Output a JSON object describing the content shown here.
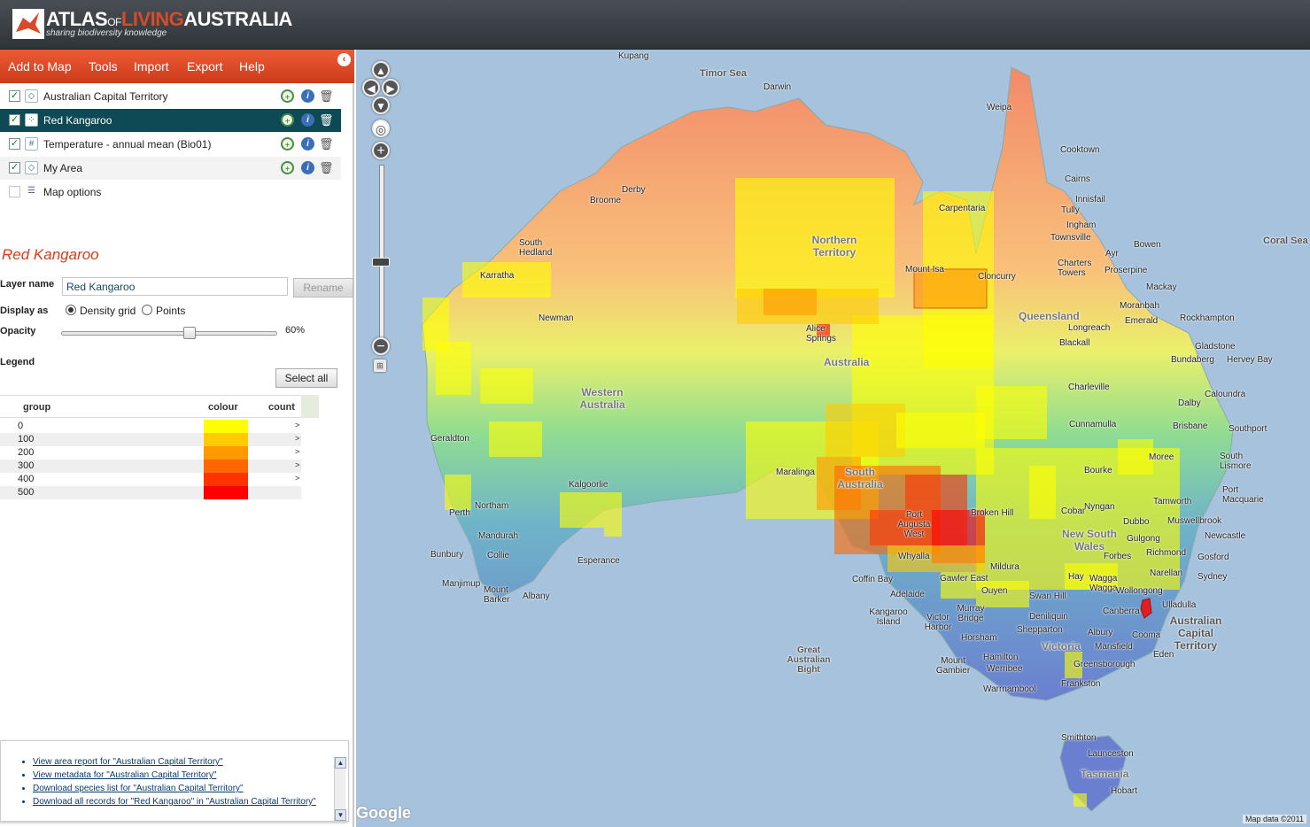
{
  "header": {
    "brand_atlas": "ATLAS",
    "brand_of": "OF",
    "brand_living": "LIVING",
    "brand_australia": "AUSTRALIA",
    "tagline": "sharing biodiversity knowledge",
    "logo_icon": "ala-logo-icon"
  },
  "menu": {
    "items": [
      "Add to Map",
      "Tools",
      "Import",
      "Export",
      "Help"
    ],
    "collapse_icon": "chevron-left-icon"
  },
  "layers": [
    {
      "name": "Australian Capital Territory",
      "checked": true,
      "icon": "area-icon"
    },
    {
      "name": "Red Kangaroo",
      "checked": true,
      "icon": "species-icon"
    },
    {
      "name": "Temperature - annual mean (Bio01)",
      "checked": true,
      "icon": "grid-icon"
    },
    {
      "name": "My Area",
      "checked": true,
      "icon": "area-icon"
    },
    {
      "name": "Map options",
      "checked": false,
      "icon": "list-icon"
    }
  ],
  "layer_panel": {
    "title": "Red Kangaroo",
    "layer_name_label": "Layer name",
    "layer_name_value": "Red Kangaroo",
    "rename_label": "Rename",
    "display_as_label": "Display as",
    "display_options": [
      "Density grid",
      "Points"
    ],
    "display_selected": "Density grid",
    "opacity_label": "Opacity",
    "opacity_value": "60%",
    "opacity_fraction": 0.6,
    "legend_label": "Legend",
    "select_all_label": "Select all"
  },
  "legend": {
    "columns": [
      "group",
      "colour",
      "count"
    ],
    "rows": [
      {
        "group": "0",
        "colour": "#ffff00",
        "count": ">"
      },
      {
        "group": "100",
        "colour": "#ffcc00",
        "count": ">"
      },
      {
        "group": "200",
        "colour": "#ff9900",
        "count": ">"
      },
      {
        "group": "300",
        "colour": "#ff6600",
        "count": ">"
      },
      {
        "group": "400",
        "colour": "#ff3300",
        "count": ">"
      },
      {
        "group": "500",
        "colour": "#ff0000",
        "count": ""
      }
    ]
  },
  "links": [
    "View area report for \"Australian Capital Territory\"",
    "View metadata for \"Australian Capital Territory\"",
    "Download species list for \"Australian Capital Territory\"",
    "Download all records for \"Red Kangaroo\" in \"Australian Capital Territory\""
  ],
  "map": {
    "attribution": "Map data ©2011",
    "google_logo": "Google",
    "labels": {
      "kupang": "Kupang",
      "timor_sea": "Timor Sea",
      "darwin": "Darwin",
      "weipa": "Weipa",
      "derby": "Derby",
      "broome": "Broome",
      "cooktown": "Cooktown",
      "cairns": "Cairns",
      "innisfail": "Innisfail",
      "tully": "Tully",
      "ingham": "Ingham",
      "townsville": "Townsville",
      "bowen": "Bowen",
      "ayr": "Ayr",
      "coral_sea": "Coral Sea",
      "carpentaria": "Carpentaria",
      "south_hedland": "South Hedland",
      "karratha": "Karratha",
      "northern_territory": "Northern Territory",
      "mount_isa": "Mount Isa",
      "cloncurry": "Cloncurry",
      "charters_towers": "Charters Towers",
      "proserpine": "Proserpine",
      "mackay": "Mackay",
      "newman": "Newman",
      "queensland": "Queensland",
      "moranbah": "Moranbah",
      "emerald": "Emerald",
      "rockhampton": "Rockhampton",
      "longreach": "Longreach",
      "alice_springs": "Alice Springs",
      "blackall": "Blackall",
      "gladstone": "Gladstone",
      "australia": "Australia",
      "bundaberg": "Bundaberg",
      "hervey_bay": "Hervey Bay",
      "western_australia": "Western Australia",
      "charleville": "Charleville",
      "caloundra": "Caloundra",
      "dalby": "Dalby",
      "geraldton": "Geraldton",
      "cunnamulla": "Cunnamulla",
      "brisbane": "Brisbane",
      "southport": "Southport",
      "moree": "Moree",
      "south_lismore": "South Lismore",
      "south_australia": "South Australia",
      "bourke": "Bourke",
      "maralinga": "Maralinga",
      "kalgoorlie": "Kalgoorlie",
      "port_macquarie": "Port Macquarie",
      "tamworth": "Tamworth",
      "nyngan": "Nyngan",
      "northam": "Northam",
      "perth": "Perth",
      "port_augusta": "Port Augusta West",
      "broken_hill": "Broken Hill",
      "cobar": "Cobar",
      "dubbo": "Dubbo",
      "muswellbrook": "Muswellbrook",
      "mandurah": "Mandurah",
      "new_south_wales": "New South Wales",
      "gulgong": "Gulgong",
      "newcastle": "Newcastle",
      "bunbury": "Bunbury",
      "collie": "Collie",
      "whyalla": "Whyalla",
      "esperance": "Esperance",
      "mildura": "Mildura",
      "forbes": "Forbes",
      "richmond": "Richmond",
      "gosford": "Gosford",
      "manjimup": "Manjimup",
      "narellan": "Narellan",
      "sydney": "Sydney",
      "coffin_bay": "Coffin Bay",
      "gawler_east": "Gawler East",
      "hay": "Hay",
      "wagga_wagga": "Wagga Wagga",
      "mount_barker": "Mount Barker",
      "albany": "Albany",
      "adelaide": "Adelaide",
      "ouyen": "Ouyen",
      "swan_hill": "Swan Hill",
      "wollongong": "Wollongong",
      "kangaroo_island": "Kangaroo Island",
      "victor_harbor": "Victor Harbor",
      "murray_bridge": "Murray Bridge",
      "deniliquin": "Deniliquin",
      "canberra": "Canberra",
      "ulladulla": "Ulladulla",
      "shepparton": "Shepparton",
      "albury": "Albury",
      "act": "Australian Capital Territory",
      "horsham": "Horsham",
      "cooma": "Cooma",
      "great_australian_bight": "Great Australian Bight",
      "victoria": "Victoria",
      "mansfield": "Mansfield",
      "eden": "Eden",
      "hamilton": "Hamilton",
      "mount_gambier": "Mount Gambier",
      "werribee": "Werribee",
      "greensborough": "Greensborough",
      "frankston": "Frankston",
      "warrnambool": "Warrnambool",
      "smithton": "Smithton",
      "launceston": "Launceston",
      "tasmania": "Tasmania",
      "hobart": "Hobart"
    }
  }
}
